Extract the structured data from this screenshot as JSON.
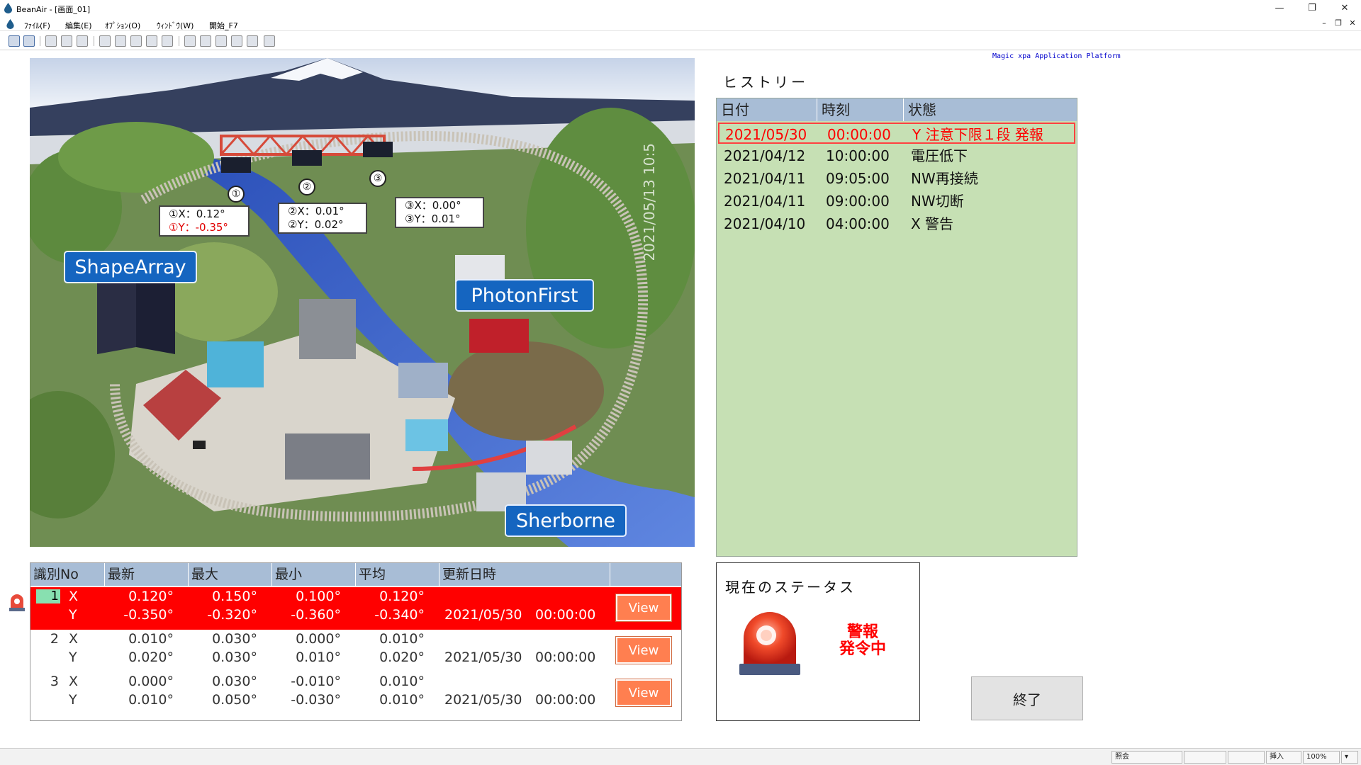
{
  "window": {
    "title": "BeanAir - [画面_01]"
  },
  "menu": [
    "ﾌｧｲﾙ(F)",
    "編集(E)",
    "ｵﾌﾟｼｮﾝ(O)",
    "ｳｨﾝﾄﾞｳ(W)",
    "開始_F7"
  ],
  "platform_label": "Magic xpa Application Platform",
  "photo": {
    "watermark": "2021/05/13 10:5",
    "brands": [
      "ShapeArray",
      "PhotonFirst",
      "Sherborne"
    ],
    "sensors": [
      {
        "no": "①",
        "x": "①X：0.12°",
        "y": "①Y：-0.35°"
      },
      {
        "no": "②",
        "x": "②X：0.01°",
        "y": "②Y：0.02°"
      },
      {
        "no": "③",
        "x": "③X：0.00°",
        "y": "③Y：0.01°"
      }
    ]
  },
  "sensor_table": {
    "headers": [
      "識別No",
      "最新",
      "最大",
      "最小",
      "平均",
      "更新日時"
    ],
    "rows": [
      {
        "id": "1",
        "x": {
          "axis": "X",
          "latest": "0.120°",
          "max": "0.150°",
          "min": "0.100°",
          "avg": "0.120°"
        },
        "y": {
          "axis": "Y",
          "latest": "-0.350°",
          "max": "-0.320°",
          "min": "-0.360°",
          "avg": "-0.340°"
        },
        "date": "2021/05/30",
        "time": "00:00:00",
        "view": "View"
      },
      {
        "id": "2",
        "x": {
          "axis": "X",
          "latest": "0.010°",
          "max": "0.030°",
          "min": "0.000°",
          "avg": "0.010°"
        },
        "y": {
          "axis": "Y",
          "latest": "0.020°",
          "max": "0.030°",
          "min": "0.010°",
          "avg": "0.020°"
        },
        "date": "2021/05/30",
        "time": "00:00:00",
        "view": "View"
      },
      {
        "id": "3",
        "x": {
          "axis": "X",
          "latest": "0.000°",
          "max": "0.030°",
          "min": "-0.010°",
          "avg": "0.010°"
        },
        "y": {
          "axis": "Y",
          "latest": "0.010°",
          "max": "0.050°",
          "min": "-0.030°",
          "avg": "0.010°"
        },
        "date": "2021/05/30",
        "time": "00:00:00",
        "view": "View"
      }
    ]
  },
  "history": {
    "title": "ヒストリー",
    "headers": [
      "日付",
      "時刻",
      "状態"
    ],
    "rows": [
      {
        "date": "2021/05/30",
        "time": "00:00:00",
        "state": "Y 注意下限１段 発報"
      },
      {
        "date": "2021/04/12",
        "time": "10:00:00",
        "state": "電圧低下"
      },
      {
        "date": "2021/04/11",
        "time": "09:05:00",
        "state": "NW再接続"
      },
      {
        "date": "2021/04/11",
        "time": "09:00:00",
        "state": "NW切断"
      },
      {
        "date": "2021/04/10",
        "time": "04:00:00",
        "state": "X 警告"
      }
    ]
  },
  "status": {
    "title": "現在のステータス",
    "line1": "警報",
    "line2": "発令中"
  },
  "exit_label": "終了",
  "statusbar": {
    "mode": "照会",
    "insert": "挿入",
    "zoom": "100%"
  },
  "colors": {
    "alarm": "#ff0000",
    "header": "#a8bdd6",
    "history_bg": "#c6e0b4",
    "view_btn": "#ff7f50",
    "brand": "#1565c0"
  }
}
